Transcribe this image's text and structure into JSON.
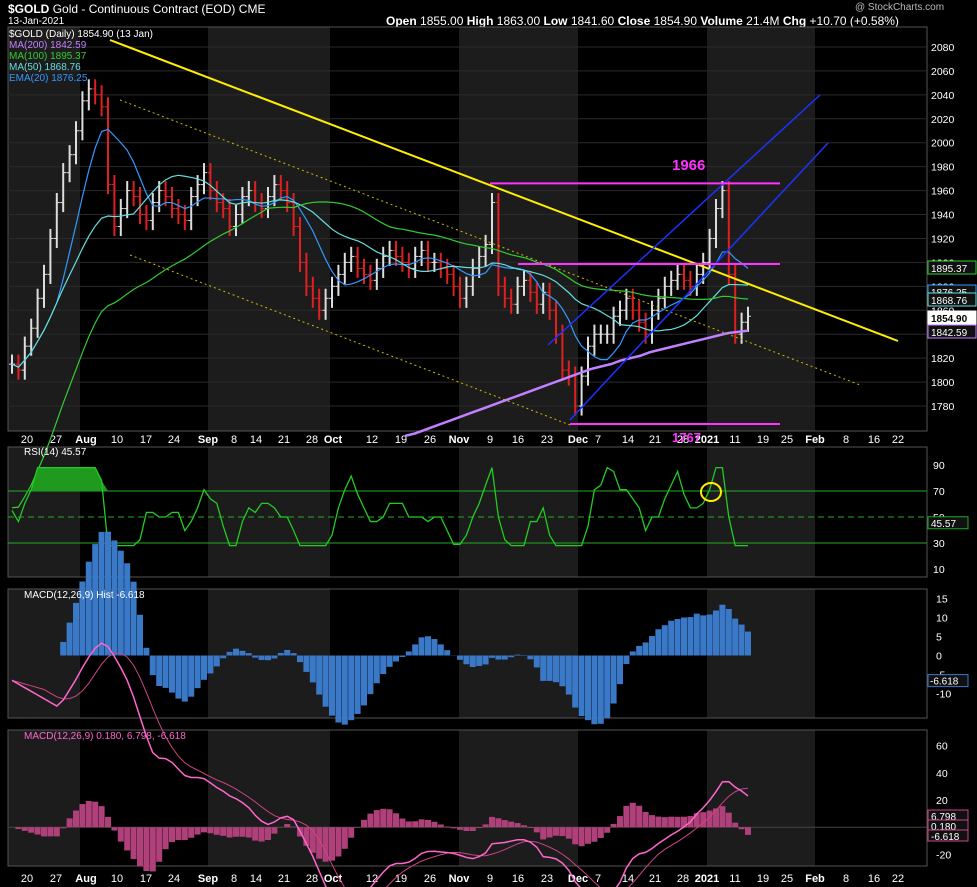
{
  "header": {
    "symbol": "$GOLD",
    "name": "Gold - Continuous Contract (EOD)",
    "exchange": "CME",
    "date": "13-Jan-2021",
    "open_label": "Open",
    "open": "1855.00",
    "high_label": "High",
    "high": "1863.00",
    "low_label": "Low",
    "low": "1841.60",
    "close_label": "Close",
    "close": "1854.90",
    "volume_label": "Volume",
    "volume": "21.4M",
    "chg_label": "Chg",
    "chg": "+10.70 (+0.58%)",
    "watermark": "@ StockCharts.com"
  },
  "price_legend": [
    {
      "text": "$GOLD (Daily) 1854.90 (13 Jan)",
      "color": "#ffffff"
    },
    {
      "text": "MA(200) 1842.59",
      "color": "#c080ff"
    },
    {
      "text": "MA(100) 1895.37",
      "color": "#33cc33"
    },
    {
      "text": "MA(50) 1868.76",
      "color": "#66dddd"
    },
    {
      "text": "EMA(20) 1876.25",
      "color": "#3399ff"
    }
  ],
  "annotations": {
    "level_high": "1966",
    "level_low": "1767"
  },
  "x_axis": [
    "20",
    "27",
    "Aug",
    "10",
    "17",
    "24",
    "Sep",
    "8",
    "14",
    "21",
    "28",
    "Oct",
    "12",
    "19",
    "26",
    "Nov",
    "9",
    "16",
    "23",
    "Dec",
    "7",
    "14",
    "21",
    "28",
    "2021",
    "11",
    "19",
    "25",
    "Feb",
    "8",
    "16",
    "22"
  ],
  "rsi": {
    "legend": "RSI(14) 45.57",
    "value_tag": "45.57",
    "ticks": [
      "90",
      "70",
      "50",
      "30",
      "10"
    ]
  },
  "macd_hist": {
    "legend": "MACD(12,26,9) Hist -6.618",
    "value_tag": "-6.618",
    "ticks": [
      "15",
      "10",
      "5",
      "0",
      "-5",
      "-10"
    ]
  },
  "macd": {
    "legend": "MACD(12,26,9) 0.180, 6.798, -6.618",
    "tag_signal": "6.798",
    "tag_macd": "0.180",
    "tag_hist": "-6.618",
    "ticks": [
      "60",
      "40",
      "20",
      "0",
      "-20"
    ]
  },
  "chart_data": {
    "type": "line",
    "title": "$GOLD Gold - Continuous Contract (EOD) CME",
    "y_ticks": [
      "2080",
      "2060",
      "2040",
      "2020",
      "2000",
      "1980",
      "1960",
      "1940",
      "1920",
      "1900",
      "1880",
      "1860",
      "1840",
      "1820",
      "1800",
      "1780"
    ],
    "value_tags": [
      {
        "text": "1895.37",
        "value": 1895.37,
        "color": "#33cc33"
      },
      {
        "text": "1876.25",
        "value": 1876.25,
        "color": "#3399ff"
      },
      {
        "text": "1868.76",
        "value": 1868.76,
        "color": "#66dddd"
      },
      {
        "text": "1854.90",
        "value": 1854.9,
        "color": "#ffffff"
      },
      {
        "text": "1842.59",
        "value": 1842.59,
        "color": "#c080ff"
      }
    ],
    "close": [
      1815,
      1810,
      1830,
      1845,
      1870,
      1890,
      1920,
      1950,
      1975,
      1990,
      2010,
      2035,
      2045,
      2040,
      2030,
      1965,
      1930,
      1945,
      1960,
      1955,
      1940,
      1935,
      1950,
      1960,
      1955,
      1945,
      1940,
      1935,
      1955,
      1965,
      1975,
      1960,
      1950,
      1945,
      1930,
      1940,
      1955,
      1960,
      1950,
      1945,
      1955,
      1965,
      1960,
      1950,
      1930,
      1900,
      1880,
      1870,
      1860,
      1870,
      1880,
      1890,
      1900,
      1905,
      1895,
      1890,
      1885,
      1895,
      1905,
      1910,
      1905,
      1900,
      1895,
      1905,
      1910,
      1900,
      1900,
      1895,
      1890,
      1880,
      1870,
      1880,
      1895,
      1905,
      1915,
      1950,
      1880,
      1870,
      1865,
      1880,
      1885,
      1875,
      1865,
      1875,
      1860,
      1840,
      1810,
      1805,
      1780,
      1805,
      1830,
      1840,
      1840,
      1840,
      1855,
      1860,
      1870,
      1860,
      1850,
      1840,
      1860,
      1870,
      1880,
      1885,
      1890,
      1885,
      1880,
      1890,
      1900,
      1920,
      1945,
      1960,
      1890,
      1840,
      1850,
      1855
    ],
    "ma200": [
      1755,
      1757,
      1760,
      1763,
      1766,
      1769,
      1772,
      1775,
      1778,
      1781,
      1784,
      1787,
      1790,
      1793,
      1796,
      1799,
      1802,
      1805,
      1808,
      1811,
      1813,
      1815,
      1818,
      1820,
      1822,
      1825,
      1827,
      1829,
      1831,
      1833,
      1835,
      1837,
      1839,
      1841,
      1842,
      1843
    ],
    "annotations": [
      "1966",
      "1767"
    ],
    "rsi_levels": [
      70,
      50,
      30
    ],
    "macd_zero": 0
  }
}
